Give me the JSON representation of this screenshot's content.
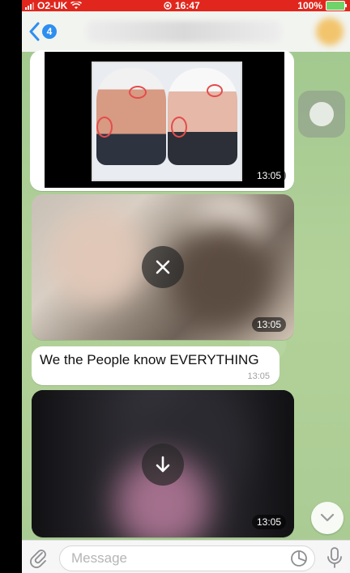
{
  "status_bar": {
    "carrier": "O2-UK",
    "time": "16:47",
    "battery": "100%"
  },
  "header": {
    "back_count": "4"
  },
  "messages": [
    {
      "type": "photo",
      "time": "13:05"
    },
    {
      "type": "video",
      "time": "13:05",
      "action_icon": "close-icon"
    },
    {
      "type": "text",
      "text": "We the People know EVERYTHING",
      "time": "13:05"
    },
    {
      "type": "video",
      "time": "13:05",
      "action_icon": "download-icon"
    }
  ],
  "composer": {
    "placeholder": "Message"
  },
  "colors": {
    "status_bar": "#e1271d",
    "accent": "#2d8ef0",
    "chat_background": "#a7c995"
  }
}
